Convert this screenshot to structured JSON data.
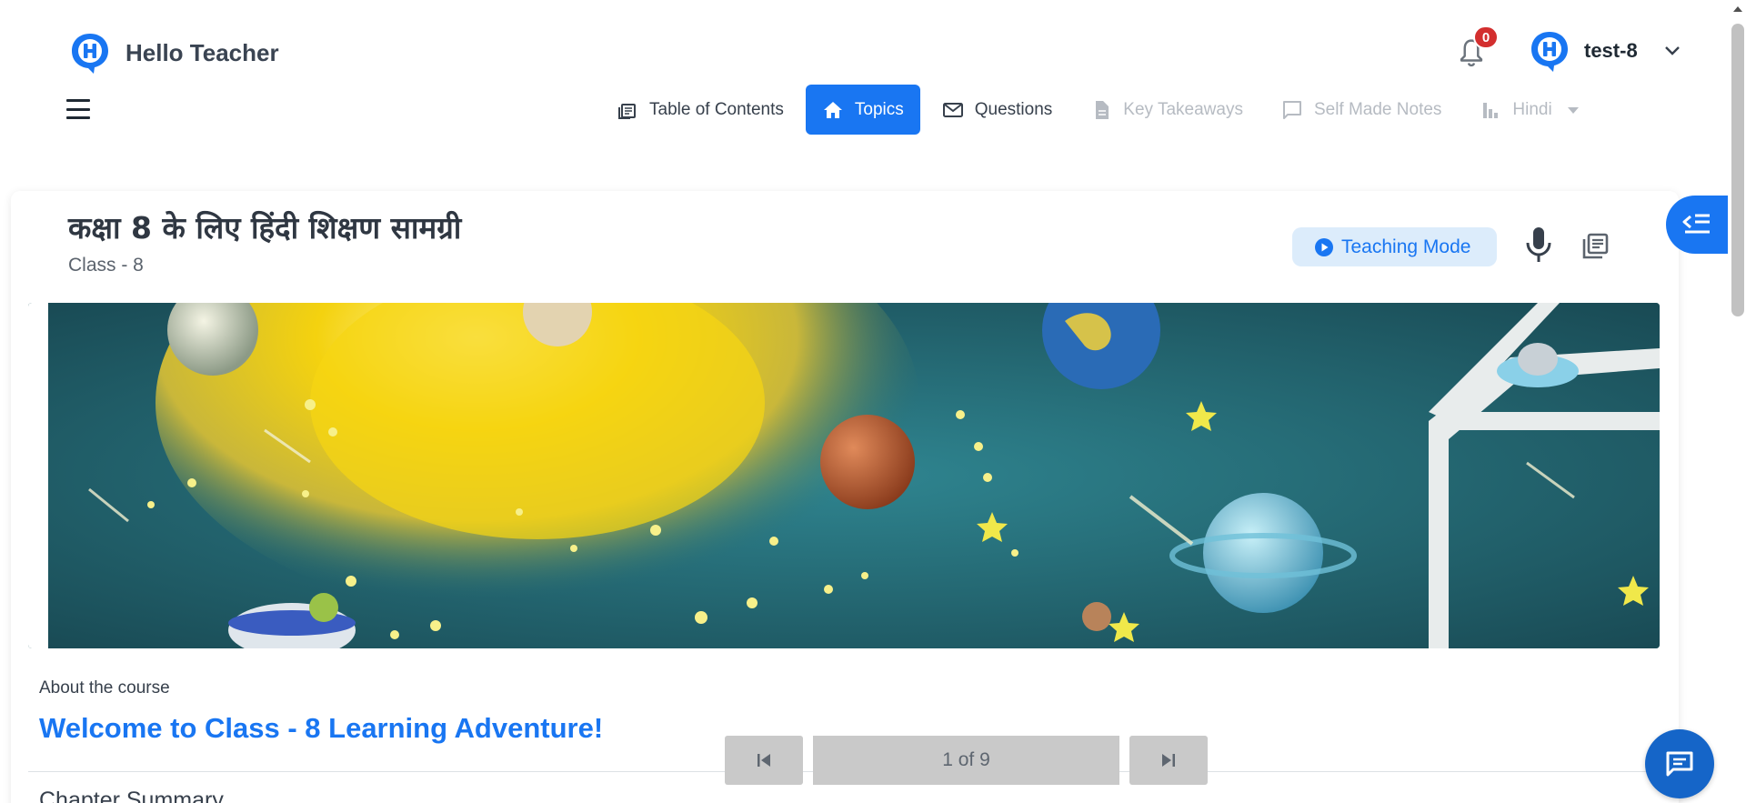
{
  "app": {
    "name": "Hello Teacher"
  },
  "notifications": {
    "count": "0"
  },
  "user": {
    "name": "test-8"
  },
  "nav": {
    "tabs": [
      {
        "label": "Table of Contents",
        "icon": "table-of-contents-icon",
        "state": "normal"
      },
      {
        "label": "Topics",
        "icon": "home-icon",
        "state": "active"
      },
      {
        "label": "Questions",
        "icon": "mail-icon",
        "state": "normal"
      },
      {
        "label": "Key Takeaways",
        "icon": "document-icon",
        "state": "disabled"
      },
      {
        "label": "Self Made Notes",
        "icon": "comment-icon",
        "state": "disabled"
      },
      {
        "label": "Hindi",
        "icon": "bar-chart-icon",
        "state": "disabled"
      }
    ]
  },
  "course": {
    "title": "कक्षा 8 के लिए हिंदी शिक्षण सामग्री",
    "class_label": "Class - 8",
    "teaching_mode_label": "Teaching Mode",
    "about_label": "About the course",
    "welcome": "Welcome to Class - 8 Learning Adventure!",
    "chapter_summary": "Chapter Summary"
  },
  "pager": {
    "label": "1 of 9"
  },
  "colors": {
    "accent": "#1976f2",
    "badge": "#d32f2f",
    "teaching_mode_bg": "#dcecfb",
    "pager_bg": "#c9c9c9",
    "chat_fab": "#1565c8"
  },
  "icons": {
    "brand": "hello-teacher-logo",
    "notifications": "bell-icon",
    "menu": "hamburger-icon",
    "teaching_mode": "play-circle-icon",
    "mic": "microphone-icon",
    "library": "library-icon",
    "sidebar_toggle": "sidebar-collapse-icon",
    "pager_first": "skip-first-icon",
    "pager_last": "skip-last-icon",
    "chat": "chat-icon"
  }
}
